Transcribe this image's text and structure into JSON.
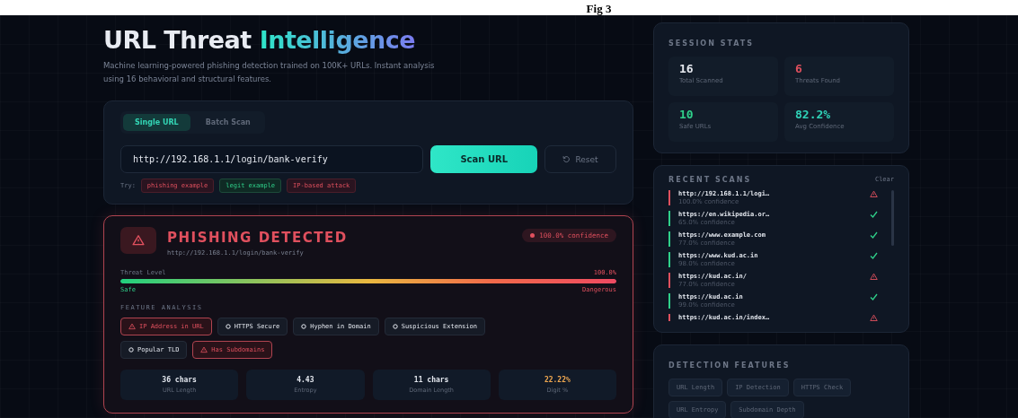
{
  "figure_caption": "Fig 3",
  "header": {
    "title": "URL Threat",
    "title_accent": "Intelligence",
    "subtitle": "Machine learning-powered phishing detection trained on 100K+ URLs. Instant analysis using 16 behavioral and structural features."
  },
  "scan": {
    "tabs": [
      {
        "label": "Single URL",
        "selected": true
      },
      {
        "label": "Batch Scan",
        "selected": false
      }
    ],
    "url_value": "http://192.168.1.1/login/bank-verify",
    "scan_button": "Scan URL",
    "reset_button": "Reset",
    "try_label": "Try:",
    "examples": [
      {
        "label": "phishing example",
        "kind": "danger"
      },
      {
        "label": "legit example",
        "kind": "safe"
      },
      {
        "label": "IP-based attack",
        "kind": "danger"
      }
    ]
  },
  "result": {
    "verdict": "PHISHING DETECTED",
    "url": "http://192.168.1.1/login/bank-verify",
    "confidence": "100.0% confidence",
    "threat_label": "Threat Level",
    "threat_value": "100.0%",
    "level": 1.0,
    "scale_low": "Safe",
    "scale_high": "Dangerous",
    "features_title": "FEATURE ANALYSIS",
    "features": [
      {
        "label": "IP Address in URL",
        "flagged": true
      },
      {
        "label": "HTTPS Secure",
        "flagged": false
      },
      {
        "label": "Hyphen in Domain",
        "flagged": false
      },
      {
        "label": "Suspicious Extension",
        "flagged": false
      },
      {
        "label": "Popular TLD",
        "flagged": false
      },
      {
        "label": "Has Subdomains",
        "flagged": true
      }
    ],
    "metrics": [
      {
        "value": "36 chars",
        "label": "URL Length",
        "highlight": false
      },
      {
        "value": "4.43",
        "label": "Entropy",
        "highlight": false
      },
      {
        "value": "11 chars",
        "label": "Domain Length",
        "highlight": false
      },
      {
        "value": "22.22%",
        "label": "Digit %",
        "highlight": true
      }
    ]
  },
  "session_stats": {
    "title": "SESSION STATS",
    "stats": [
      {
        "value": "16",
        "label": "Total Scanned",
        "color": "#e6e9ef"
      },
      {
        "value": "6",
        "label": "Threats Found",
        "color": "#e0505e"
      },
      {
        "value": "10",
        "label": "Safe URLs",
        "color": "#2fd08a"
      },
      {
        "value": "82.2%",
        "label": "Avg Confidence",
        "color": "#2fd3b8"
      }
    ]
  },
  "recent_scans": {
    "title": "RECENT SCANS",
    "clear": "Clear",
    "items": [
      {
        "url": "http://192.168.1.1/logi…",
        "confidence": "100.0% confidence",
        "threat": true
      },
      {
        "url": "https://en.wikipedia.or…",
        "confidence": "65.0% confidence",
        "threat": false
      },
      {
        "url": "https://www.example.com",
        "confidence": "77.0% confidence",
        "threat": false
      },
      {
        "url": "https://www.kud.ac.in",
        "confidence": "98.0% confidence",
        "threat": false
      },
      {
        "url": "https://kud.ac.in/",
        "confidence": "77.0% confidence",
        "threat": true
      },
      {
        "url": "https://kud.ac.in",
        "confidence": "99.0% confidence",
        "threat": false
      },
      {
        "url": "https://kud.ac.in/index…",
        "threat": true
      }
    ]
  },
  "detection_features": {
    "title": "DETECTION FEATURES",
    "chips": [
      "URL Length",
      "IP Detection",
      "HTTPS Check",
      "URL Entropy",
      "Subdomain Depth"
    ]
  }
}
